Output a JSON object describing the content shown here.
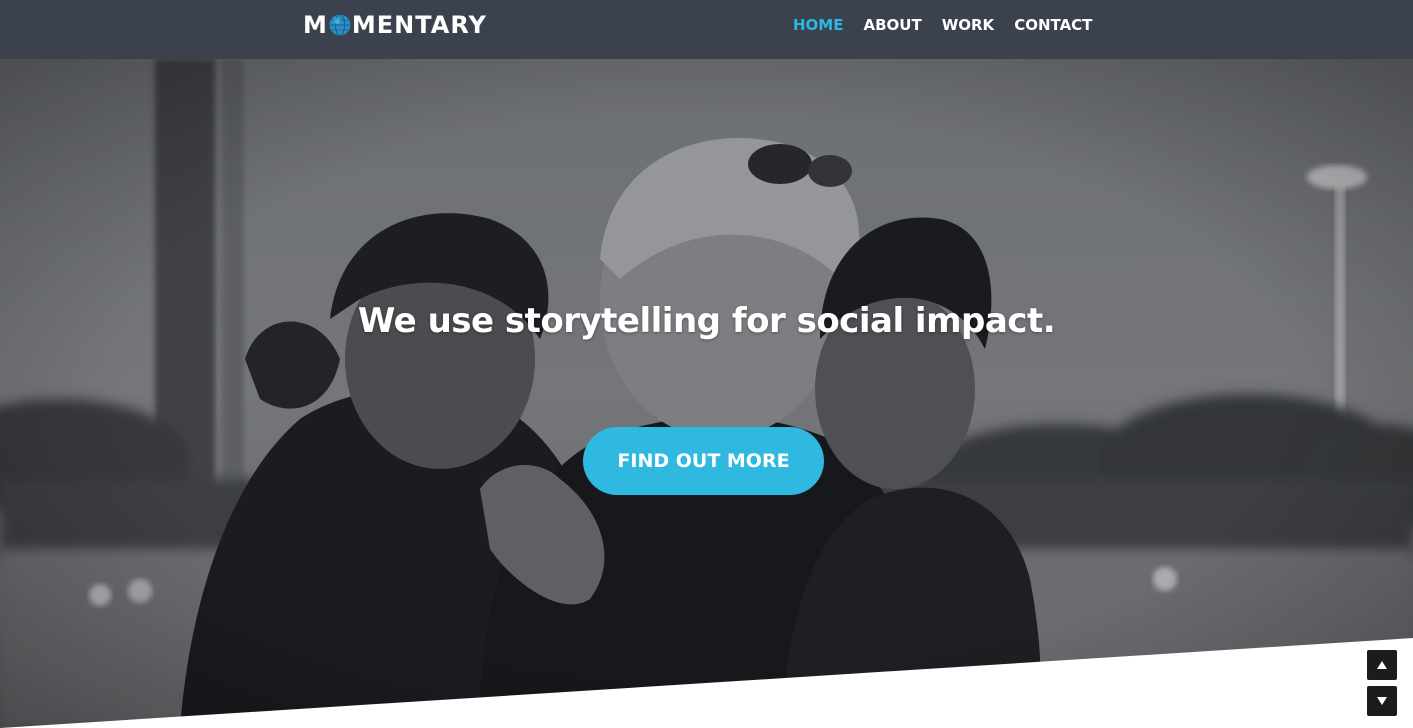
{
  "brand": {
    "name_before": "M",
    "name_after": "MENTARY",
    "accent": "#2eb8e0",
    "logo_icon": "globe-icon"
  },
  "nav": {
    "items": [
      {
        "label": "HOME",
        "active": true
      },
      {
        "label": "ABOUT",
        "active": false
      },
      {
        "label": "WORK",
        "active": false
      },
      {
        "label": "CONTACT",
        "active": false
      }
    ]
  },
  "hero": {
    "headline": "We use storytelling for social impact.",
    "cta_label": "FIND OUT MORE",
    "background": "grayscale photo of three people walking arm in arm"
  },
  "controls": {
    "scroll_up_icon": "triangle-up-icon",
    "scroll_down_icon": "triangle-down-icon"
  },
  "colors": {
    "navbar": "#3b424e",
    "cta": "#2fb9e0",
    "active_nav": "#2eb8e0"
  }
}
